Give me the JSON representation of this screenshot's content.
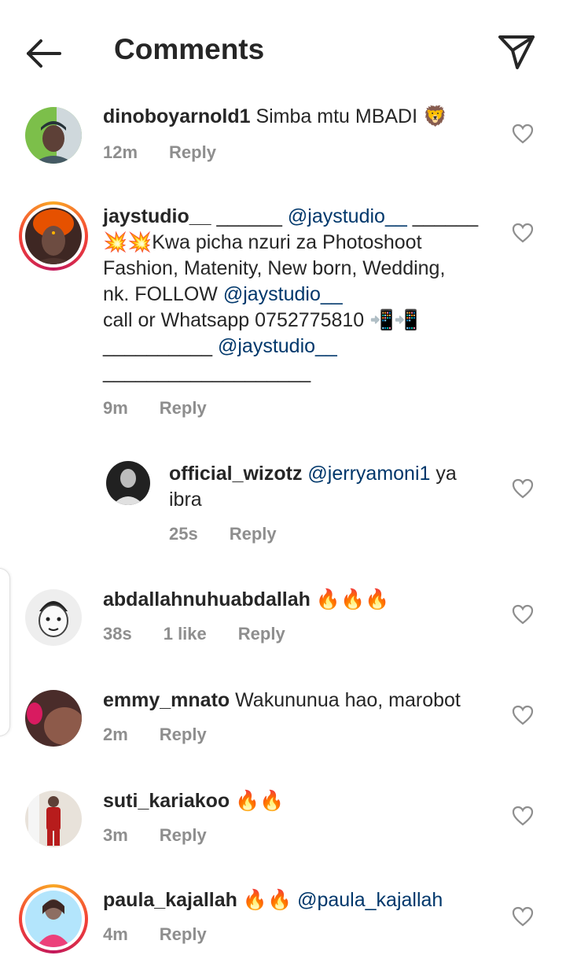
{
  "header": {
    "title": "Comments",
    "back_icon": "arrow-left-icon",
    "share_icon": "paper-plane-icon"
  },
  "comments": [
    {
      "username": "dinoboyarnold1",
      "text": "Simba mtu MBADI 🦁",
      "time": "12m",
      "reply": "Reply"
    },
    {
      "username": "jaystudio__",
      "line1_a": "______ ",
      "mention1": "@jaystudio__",
      "line1_b": " ______",
      "line2": "💥💥Kwa picha nzuri za Photoshoot",
      "line3": "Fashion, Matenity, New born, Wedding,",
      "line4_a": "nk. FOLLOW ",
      "mention2": "@jaystudio__",
      "line5": "call or Whatsapp 0752775810 📲📲",
      "line6_a": "__________ ",
      "mention3": "@jaystudio__",
      "line7": "___________________",
      "time": "9m",
      "reply": "Reply"
    },
    {
      "username": "official_wizotz",
      "mention": "@jerryamoni1",
      "text_a": " ya",
      "text_b": "ibra",
      "time": "25s",
      "reply": "Reply"
    },
    {
      "username": "abdallahnuhuabdallah",
      "text": "🔥🔥🔥",
      "time": "38s",
      "likes": "1 like",
      "reply": "Reply"
    },
    {
      "username": "emmy_mnato",
      "text": "Wakununua hao, marobot",
      "time": "2m",
      "reply": "Reply"
    },
    {
      "username": "suti_kariakoo",
      "text": "🔥🔥",
      "time": "3m",
      "reply": "Reply"
    },
    {
      "username": "paula_kajallah",
      "text": "🔥🔥 ",
      "mention": "@paula_kajallah",
      "time": "4m",
      "reply": "Reply"
    }
  ],
  "colors": {
    "text": "#262626",
    "muted": "#8e8e8e",
    "mention": "#00376b",
    "story_ring_start": "#f9a825",
    "story_ring_end": "#c2185b"
  }
}
